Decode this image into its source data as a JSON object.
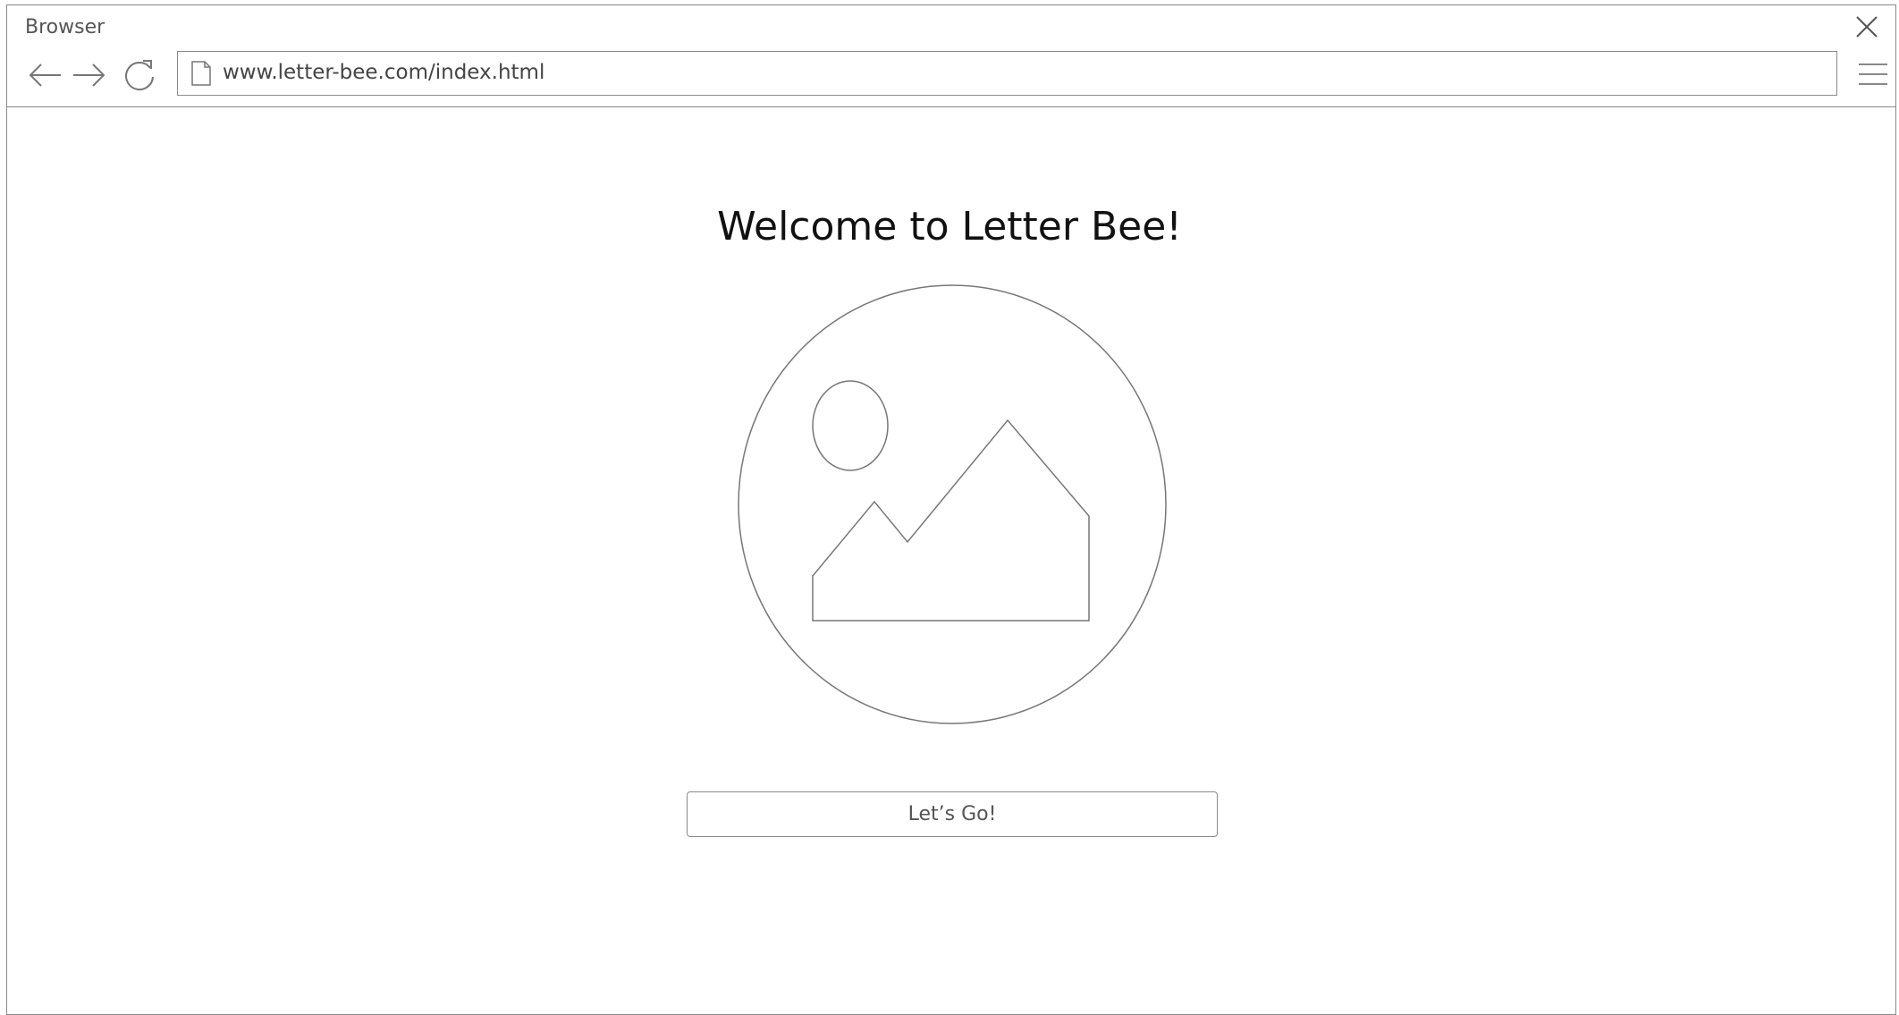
{
  "window": {
    "title": "Browser",
    "close_icon": "close-icon",
    "menu_icon": "hamburger-menu-icon"
  },
  "nav": {
    "back_icon": "arrow-left-icon",
    "forward_icon": "arrow-right-icon",
    "reload_icon": "reload-icon"
  },
  "address_bar": {
    "page_icon": "page-icon",
    "url": "www.letter-bee.com/index.html"
  },
  "main": {
    "heading": "Welcome to Letter Bee!",
    "image_icon": "image-placeholder-icon",
    "button_label": "Let’s Go!"
  },
  "colors": {
    "stroke": "#8a8a8a",
    "background": "#ffffff",
    "heading_text": "#111111"
  }
}
